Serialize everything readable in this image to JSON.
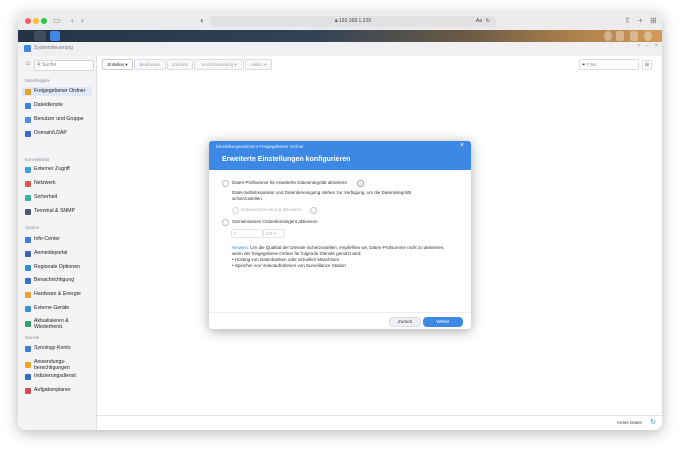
{
  "browser": {
    "url": "192.168.1.229",
    "reader_label": "Aa"
  },
  "app": {
    "title": "Systemsteuerung"
  },
  "sidebar": {
    "search_placeholder": "Suche",
    "sections": [
      {
        "title": "Dateifreigabe",
        "items": [
          {
            "label": "Freigegebener Ordner",
            "icon": "folder-icon",
            "color": "#f0a020",
            "active": true
          },
          {
            "label": "Dateidienste",
            "icon": "file-services-icon",
            "color": "#3a7fd8"
          },
          {
            "label": "Benutzer und Gruppe",
            "icon": "users-icon",
            "color": "#4a90e2"
          },
          {
            "label": "Domain/LDAP",
            "icon": "domain-icon",
            "color": "#3568c8"
          }
        ]
      },
      {
        "title": "Konnektivität",
        "items": [
          {
            "label": "Externer Zugriff",
            "icon": "globe-icon",
            "color": "#3aa0e0"
          },
          {
            "label": "Netzwerk",
            "icon": "network-icon",
            "color": "#d85a4a"
          },
          {
            "label": "Sicherheit",
            "icon": "shield-icon",
            "color": "#3bb0a0"
          },
          {
            "label": "Terminal & SNMP",
            "icon": "terminal-icon",
            "color": "#4a5a70"
          }
        ]
      },
      {
        "title": "System",
        "items": [
          {
            "label": "Info-Center",
            "icon": "info-icon",
            "color": "#3a7fd8"
          },
          {
            "label": "Anmeldeportal",
            "icon": "portal-icon",
            "color": "#3a60c0"
          },
          {
            "label": "Regionale Optionen",
            "icon": "region-icon",
            "color": "#2d8fd0"
          },
          {
            "label": "Benachrichtigung",
            "icon": "notification-icon",
            "color": "#3070d0"
          },
          {
            "label": "Hardware & Energie",
            "icon": "hardware-icon",
            "color": "#f0a030"
          },
          {
            "label": "Externe Geräte",
            "icon": "external-device-icon",
            "color": "#3a90d8"
          },
          {
            "label": "Aktualisieren & Wiederherst.",
            "icon": "update-icon",
            "color": "#2da070"
          }
        ]
      },
      {
        "title": "Dienste",
        "items": [
          {
            "label": "Synology-Konto",
            "icon": "account-icon",
            "color": "#3a7fd8"
          },
          {
            "label": "Anwendungs-berechtigungen",
            "icon": "permission-icon",
            "color": "#f0a020"
          },
          {
            "label": "Indizierungsdienst",
            "icon": "index-icon",
            "color": "#2f6fd0"
          },
          {
            "label": "Aufgabenplaner",
            "icon": "scheduler-icon",
            "color": "#d84a4a"
          }
        ]
      }
    ]
  },
  "toolbar": {
    "create": "Erstellen",
    "edit": "Bearbeiten",
    "delete": "Löschen",
    "encryption": "Verschlüsselung",
    "action": "Aktion",
    "filter_placeholder": "Filter"
  },
  "status": {
    "no_data": "Keine Daten"
  },
  "dialog": {
    "window_title": "Einstellungsassistent Freigegebener Ordner",
    "heading": "Erweiterte Einstellungen konfigurieren",
    "checksum_label": "Daten-Prüfsumme für erweiterte Datenintegrität aktivieren",
    "checksum_desc": "Datei-Selbstreparatur und Datenbereinigung stehen zur Verfügung, um die Datenintegrität sicherzustellen.",
    "compression_label": "Dateikomprimierung aktivieren",
    "quota_label": "Gemeinsames Ordnerkontingent aktivieren",
    "quota_value": "0",
    "quota_unit": "GB",
    "hint_prefix": "Hinweis:",
    "hint_text": "Um die Qualität der Dienste sicherzustellen, empfehlen wir, Daten-Prüfsumme nicht zu aktivieren, wenn der freigegebene Ordner für folgende Dienste genutzt wird:",
    "bullets": [
      "Hosting von Datenbanken oder virtuellen Maschinen",
      "Speicher von Videoaufnahmen von Surveillance Station"
    ],
    "back_label": "Zurück",
    "next_label": "Weiter"
  },
  "colors": {
    "accent": "#3d88e4",
    "dialog_header": "#3d88e4"
  }
}
